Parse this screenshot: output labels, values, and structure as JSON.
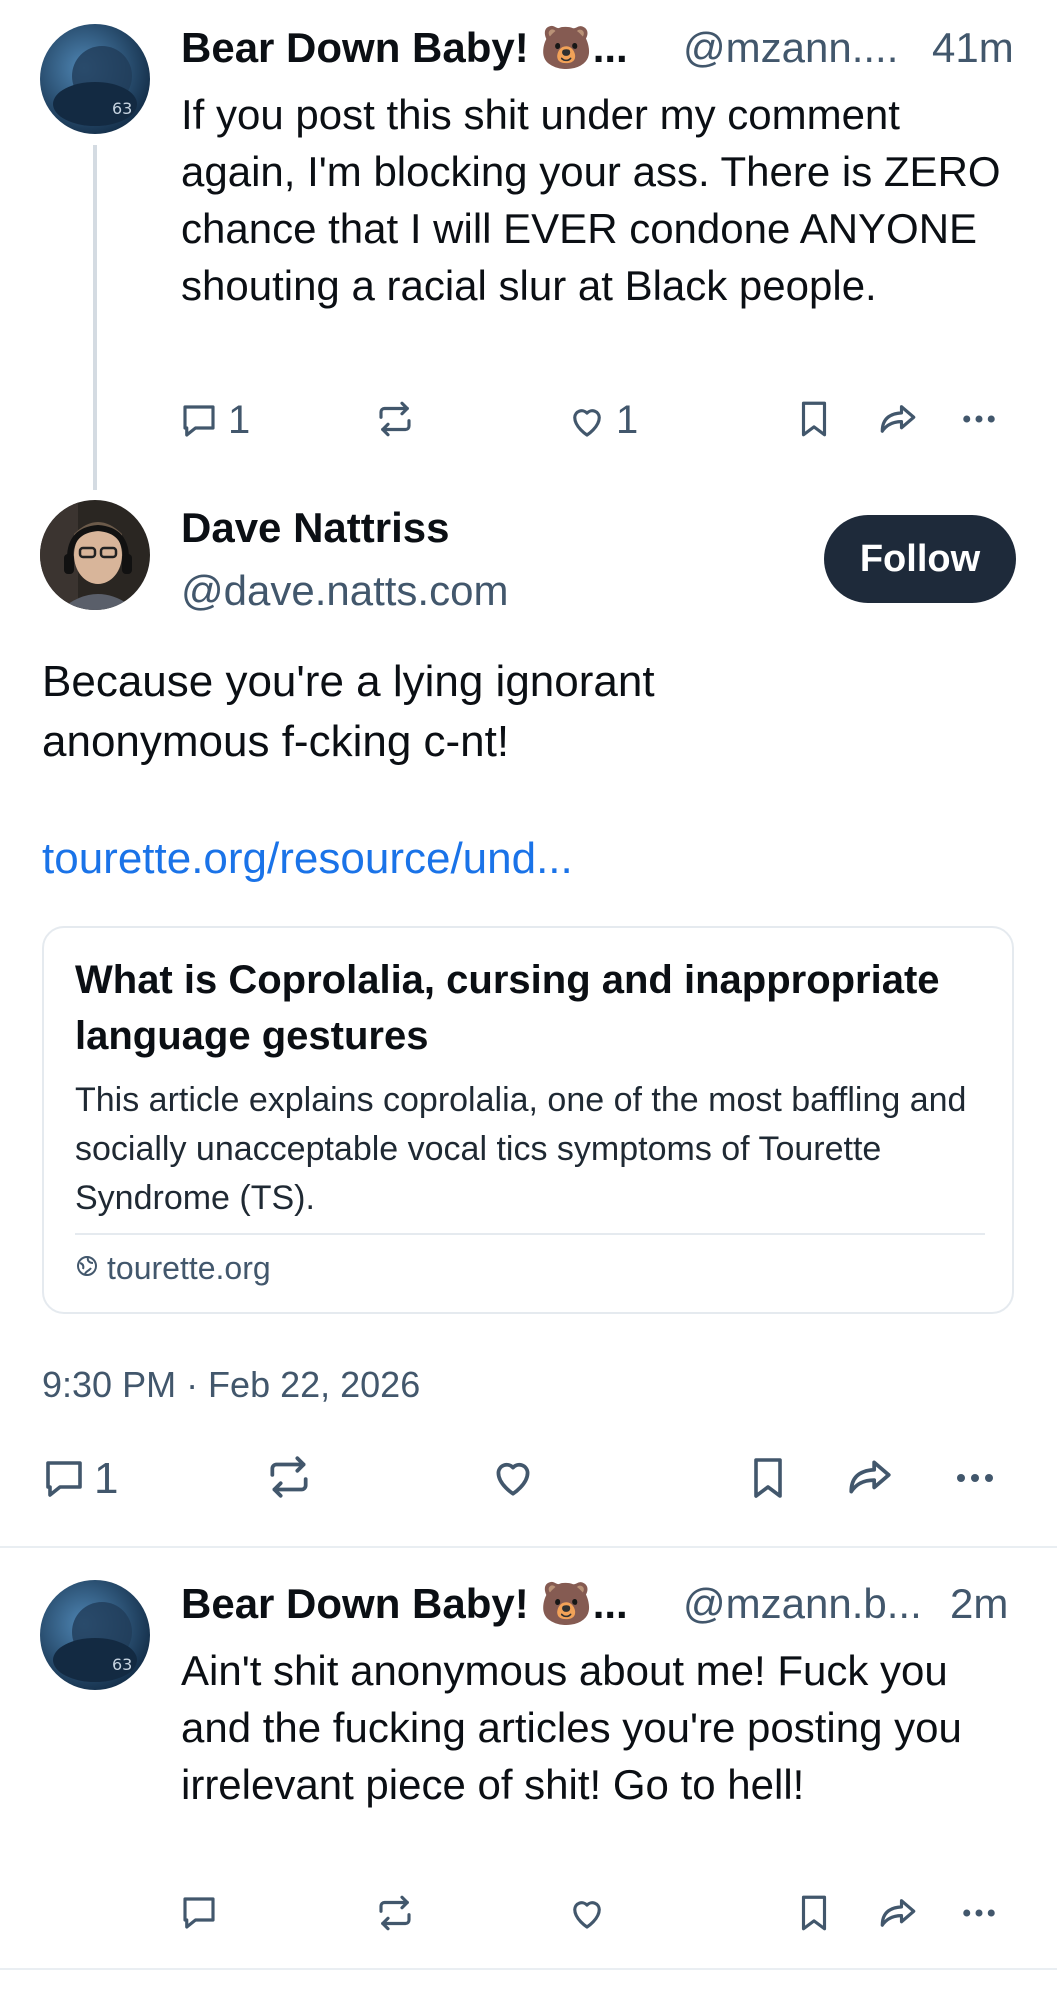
{
  "posts": [
    {
      "name": "Bear Down Baby! 🐻...",
      "handle": "@mzann....",
      "time": "41m",
      "text": "If you post this shit under my comment again, I'm blocking your ass. There is ZERO chance that I will EVER condone ANYONE shouting a racial slur at Black people.",
      "reply_count": "1",
      "like_count": "1"
    },
    {
      "name": "Dave Nattriss",
      "handle": "@dave.natts.com",
      "follow_label": "Follow",
      "text": "Because you're a lying ignorant anonymous f-cking c-nt!",
      "link": "tourette.org/resource/und...",
      "card_title": "What is Coprolalia, cursing and inappropriate language gestures",
      "card_desc": "This article explains coprolalia, one of the most baffling and socially unacceptable vocal tics symptoms of Tourette Syndrome (TS).",
      "card_domain": "tourette.org",
      "timestamp": "9:30 PM · Feb 22, 2026",
      "reply_count": "1"
    },
    {
      "name": "Bear Down Baby! 🐻...",
      "handle": "@mzann.b...",
      "time": "2m",
      "text": "Ain't shit anonymous about me! Fuck you and the fucking articles you're posting you irrelevant piece of shit! Go to hell!"
    }
  ],
  "colors": {
    "link": "#1a73e8",
    "muted": "#42576c",
    "follow_bg": "#1e2a3a"
  },
  "icons": [
    "reply-icon",
    "repost-icon",
    "like-icon",
    "bookmark-icon",
    "share-icon",
    "more-icon",
    "globe-icon"
  ]
}
